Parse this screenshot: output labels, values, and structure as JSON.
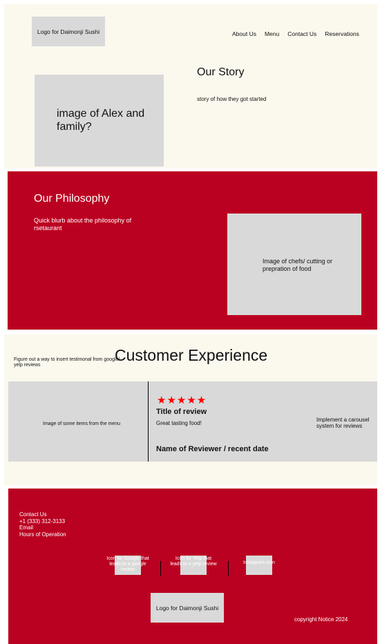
{
  "header": {
    "logo": "Logo for Daimonji Sushi",
    "nav": [
      "About Us",
      "Menu",
      "Contact Us",
      "Reservations"
    ]
  },
  "story": {
    "image_placeholder": "image of Alex and family?",
    "title": "Our Story",
    "body": "story of how they got started"
  },
  "philosophy": {
    "title": "Our Philosophy",
    "body": "Quick blurb about the philosophy of rsetaurant",
    "image_placeholder": "Image of chefs/ cutting or prepration of food"
  },
  "customer_experience": {
    "note": "Figure out a way to insert testimonal from google/ yelp reviews",
    "title": "Customer Experience",
    "menu_image_placeholder": "Image of some items from the menu",
    "review": {
      "stars": "★★★★★",
      "rating": 5,
      "title": "Title of review",
      "text": "Great tasting food!",
      "reviewer": "Name of Reviewer / recent date"
    },
    "carousel_note": "Implement a carousel system for reviews"
  },
  "footer": {
    "contact": {
      "heading": "Contact Us",
      "phone": "+1 (333) 312-3133",
      "email": "Email",
      "hours": "Hours of Operation"
    },
    "icons": {
      "google": "Icon for Google that leads to a google review",
      "yelp": "Icon for Yelp that leads to a yelp review",
      "instagram": "Instagram icon"
    },
    "logo": "Logo for Daimonji Sushi",
    "copyright": "copyright Notice 2024"
  },
  "colors": {
    "brand_red": "#bb0121",
    "cream": "#fbf8ee",
    "placeholder_gray": "#d9d9d9",
    "star_red": "#ff0000"
  }
}
